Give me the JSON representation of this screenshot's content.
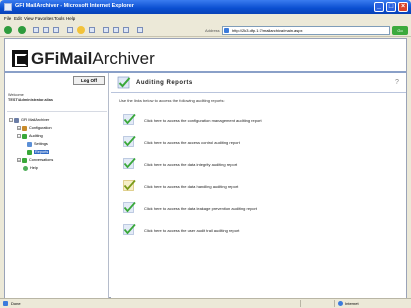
{
  "window": {
    "title": "GFI MailArchiver - Microsoft Internet Explorer",
    "minimize": "_",
    "maximize": "□",
    "close": "×"
  },
  "menu": [
    "File",
    "Edit",
    "View",
    "Favorites",
    "Tools",
    "Help"
  ],
  "address": {
    "label": "Address",
    "value": "http://2k3.dfp.1:7/mailarchiva/main.aspx",
    "go_label": "Go"
  },
  "brand": {
    "gfi": "GFi",
    "mail": "Mail",
    "archiver": "Archiver"
  },
  "sidebar": {
    "logoff_label": "Log Off",
    "user_lines": [
      "Welcome",
      "TEST\\Administrator.alias"
    ],
    "tree": [
      {
        "label": "GFI MailArchiver",
        "icon": "computer-icon"
      },
      {
        "label": "Configuration",
        "icon": "gear-icon"
      },
      {
        "label": "Auditing",
        "icon": "check-icon"
      },
      {
        "label": "Settings",
        "icon": "settings-icon"
      },
      {
        "label": "Reports",
        "icon": "report-icon"
      },
      {
        "label": "Conversations",
        "icon": "conversation-icon"
      },
      {
        "label": "Help",
        "icon": "help-icon"
      }
    ]
  },
  "content": {
    "title": "Auditing Reports",
    "intro": "Use the links below to access the following auditing reports:",
    "help_glyph": "?",
    "reports": [
      "Click here to access the configuration management auditing report",
      "Click here to access the access control auditing report",
      "Click here to access the data integrity auditing report",
      "Click here to access the data handling auditing report",
      "Click here to access the data leakage prevention auditing report",
      "Click here to access the user audit trail auditing report"
    ]
  },
  "status": {
    "left": "Done",
    "zone": "Internet"
  },
  "colors": {
    "titlebar": "#0a4ed0",
    "selection": "#316ac5",
    "check_green": "#3aa83a",
    "check_yellow": "#e2c21a"
  }
}
